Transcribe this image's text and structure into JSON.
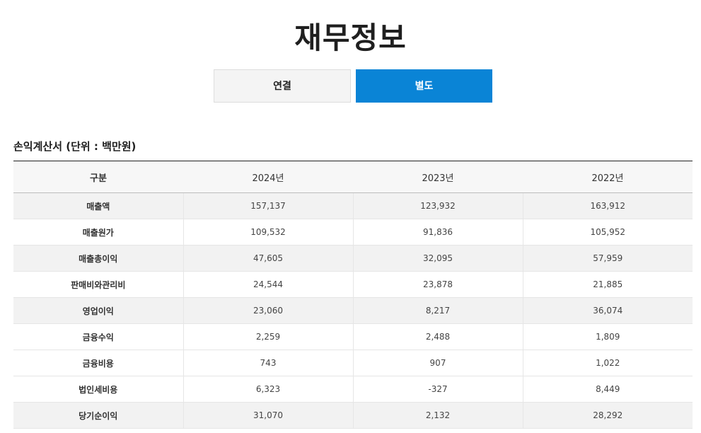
{
  "page": {
    "title": "재무정보"
  },
  "tabs": [
    {
      "label": "연결",
      "active": false
    },
    {
      "label": "별도",
      "active": true
    }
  ],
  "colors": {
    "accent": "#0a84d6",
    "tab_inactive_bg": "#f4f4f4",
    "row_shade": "#f2f2f2"
  },
  "section": {
    "title": "손익계산서 (단위 : 백만원)"
  },
  "table": {
    "headers": [
      "구분",
      "2024년",
      "2023년",
      "2022년"
    ],
    "rows": [
      {
        "label": "매출액",
        "values": [
          "157,137",
          "123,932",
          "163,912"
        ],
        "shaded": true
      },
      {
        "label": "매출원가",
        "values": [
          "109,532",
          "91,836",
          "105,952"
        ],
        "shaded": false
      },
      {
        "label": "매출총이익",
        "values": [
          "47,605",
          "32,095",
          "57,959"
        ],
        "shaded": true
      },
      {
        "label": "판매비와관리비",
        "values": [
          "24,544",
          "23,878",
          "21,885"
        ],
        "shaded": false
      },
      {
        "label": "영업이익",
        "values": [
          "23,060",
          "8,217",
          "36,074"
        ],
        "shaded": true
      },
      {
        "label": "금융수익",
        "values": [
          "2,259",
          "2,488",
          "1,809"
        ],
        "shaded": false
      },
      {
        "label": "금융비용",
        "values": [
          "743",
          "907",
          "1,022"
        ],
        "shaded": false
      },
      {
        "label": "법인세비용",
        "values": [
          "6,323",
          "-327",
          "8,449"
        ],
        "shaded": false
      },
      {
        "label": "당기순이익",
        "values": [
          "31,070",
          "2,132",
          "28,292"
        ],
        "shaded": true
      }
    ]
  }
}
